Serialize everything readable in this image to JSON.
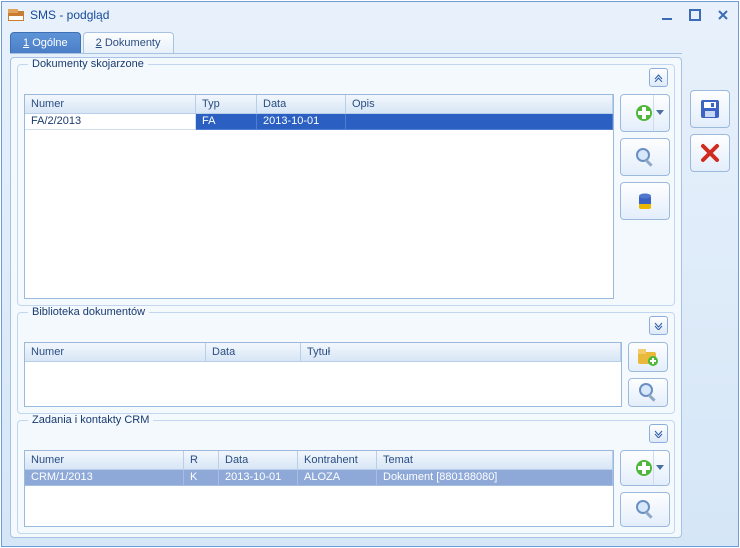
{
  "window": {
    "title": "SMS - podgląd"
  },
  "tabs": [
    {
      "accel": "1",
      "label": "Ogólne",
      "active": true
    },
    {
      "accel": "2",
      "label": "Dokumenty",
      "active": false
    }
  ],
  "groups": {
    "documents_linked": {
      "title": "Dokumenty skojarzone",
      "columns": [
        "Numer",
        "Typ",
        "Data",
        "Opis"
      ],
      "rows": [
        {
          "numer": "FA/2/2013",
          "typ": "FA",
          "data": "2013-10-01",
          "opis": "",
          "selected": true
        }
      ]
    },
    "library": {
      "title": "Biblioteka dokumentów",
      "columns": [
        "Numer",
        "Data",
        "Tytuł"
      ],
      "rows": []
    },
    "crm": {
      "title": "Zadania i kontakty CRM",
      "columns": [
        "Numer",
        "R",
        "Data",
        "Kontrahent",
        "Temat"
      ],
      "rows": [
        {
          "numer": "CRM/1/2013",
          "r": "K",
          "data": "2013-10-01",
          "kontrahent": "ALOZA",
          "temat": "Dokument [880188080]",
          "selected": true
        }
      ]
    }
  },
  "icons": {
    "add": "add-icon",
    "search": "search-icon",
    "trash": "trash-icon",
    "add_folder": "add-folder-icon",
    "save": "save-icon",
    "cancel": "cancel-icon"
  }
}
